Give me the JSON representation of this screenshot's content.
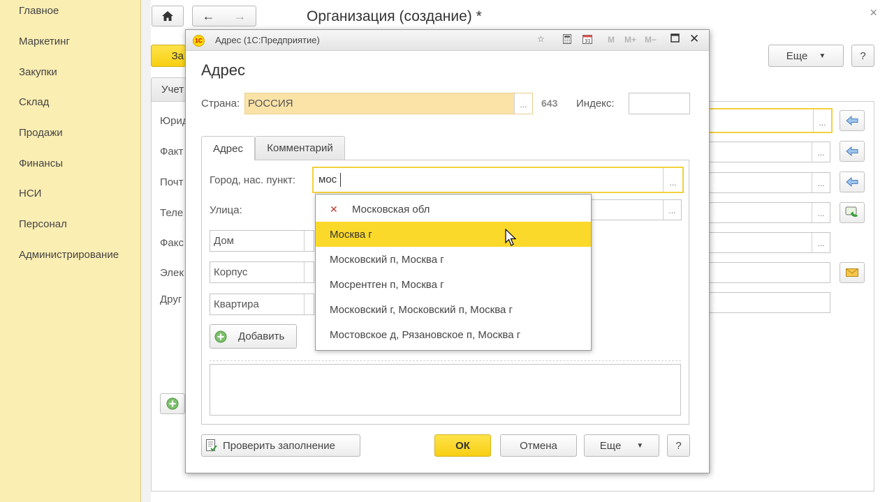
{
  "sidebar": {
    "items": [
      {
        "label": "Главное"
      },
      {
        "label": "Маркетинг"
      },
      {
        "label": "Закупки"
      },
      {
        "label": "Склад"
      },
      {
        "label": "Продажи"
      },
      {
        "label": "Финансы"
      },
      {
        "label": "НСИ"
      },
      {
        "label": "Персонал"
      },
      {
        "label": "Администрирование"
      }
    ]
  },
  "main": {
    "title": "Организация (создание) *",
    "save_button_partial": "За",
    "tab_partial": "Учет",
    "more_button": "Еще",
    "help_button": "?",
    "close": "×",
    "labels": [
      "Юрид",
      "Факт",
      "Почт",
      "Теле",
      "Факс",
      "Элек",
      "Друг"
    ]
  },
  "dialog": {
    "caption": "Адрес  (1С:Предприятие)",
    "title": "Адрес",
    "country_label": "Страна:",
    "country_value": "РОССИЯ",
    "country_code": "643",
    "index_label": "Индекс:",
    "index_value": "",
    "tabs": [
      {
        "label": "Адрес"
      },
      {
        "label": "Комментарий"
      }
    ],
    "city_label": "Город, нас. пункт:",
    "city_value": "мос",
    "street_label": "Улица:",
    "house_field": "Дом",
    "building_field": "Корпус",
    "apartment_field": "Квартира",
    "add_button": "Добавить",
    "check_button": "Проверить заполнение",
    "ok_button": "ОК",
    "cancel_button": "Отмена",
    "more_button": "Еще",
    "help_button": "?",
    "header_m_buttons": [
      "M",
      "M+",
      "M−"
    ],
    "suggestions": [
      {
        "label": "Московская обл",
        "icon": "clear-x-icon"
      },
      {
        "label": "Москва г",
        "selected": true
      },
      {
        "label": "Московский п, Москва г"
      },
      {
        "label": "Мосрентген п, Москва г"
      },
      {
        "label": "Московский г, Московский п, Москва г"
      },
      {
        "label": "Мостовское д, Рязановское п, Москва г"
      }
    ]
  },
  "colors": {
    "sidebar_bg": "#fbeeb3",
    "accent_yellow": "#fbd92a",
    "highlight_border": "#f2d13c",
    "country_field_bg": "#fbe3a8"
  }
}
